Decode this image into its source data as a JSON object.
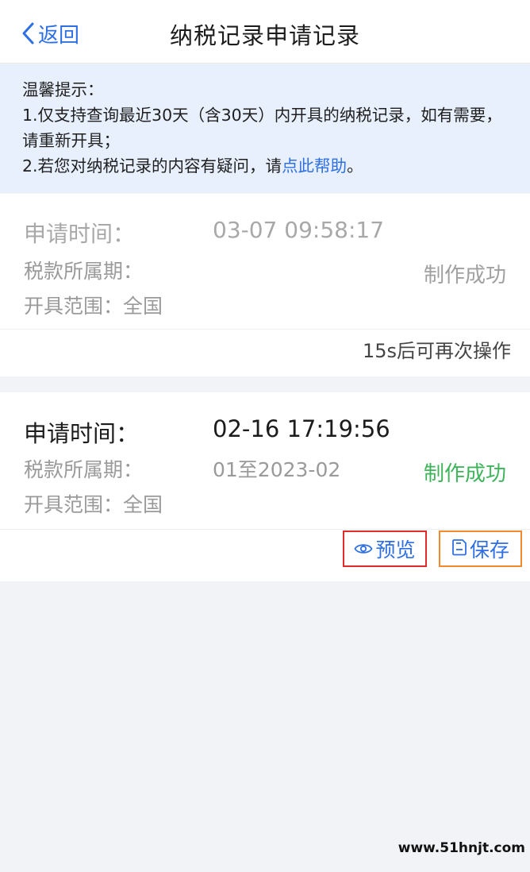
{
  "navbar": {
    "back_label": "返回",
    "title": "纳税记录申请记录"
  },
  "tip": {
    "heading": "温馨提示：",
    "line1": "1.仅支持查询最近30天（含30天）内开具的纳税记录，如有需要，请重新开具；",
    "line2_prefix": "2.若您对纳税记录的内容有疑问，请",
    "line2_link": "点此帮助",
    "line2_suffix": "。"
  },
  "records": [
    {
      "apply_label": "申请时间：",
      "apply_time": "03-07 09:58:17",
      "period_label": "税款所属期：",
      "period_value": "",
      "scope_label": "开具范围：全国",
      "status": "制作成功",
      "cooldown": "15s后可再次操作"
    },
    {
      "apply_label": "申请时间：",
      "apply_time": "02-16 17:19:56",
      "period_label": "税款所属期：",
      "period_value": "01至2023-02",
      "scope_label": "开具范围：全国",
      "status": "制作成功",
      "preview_label": "预览",
      "save_label": "保存"
    }
  ],
  "watermark": "www.51hnjt.com",
  "colors": {
    "accent": "#2f6fe4",
    "success": "#3fb55b",
    "tip_bg": "#e8f0fd",
    "page_bg": "#f2f3f7",
    "preview_outline": "#e02b2b",
    "save_outline": "#f28a2d"
  },
  "icons": {
    "back": "chevron-left-icon",
    "preview": "eye-icon",
    "save": "save-icon"
  }
}
